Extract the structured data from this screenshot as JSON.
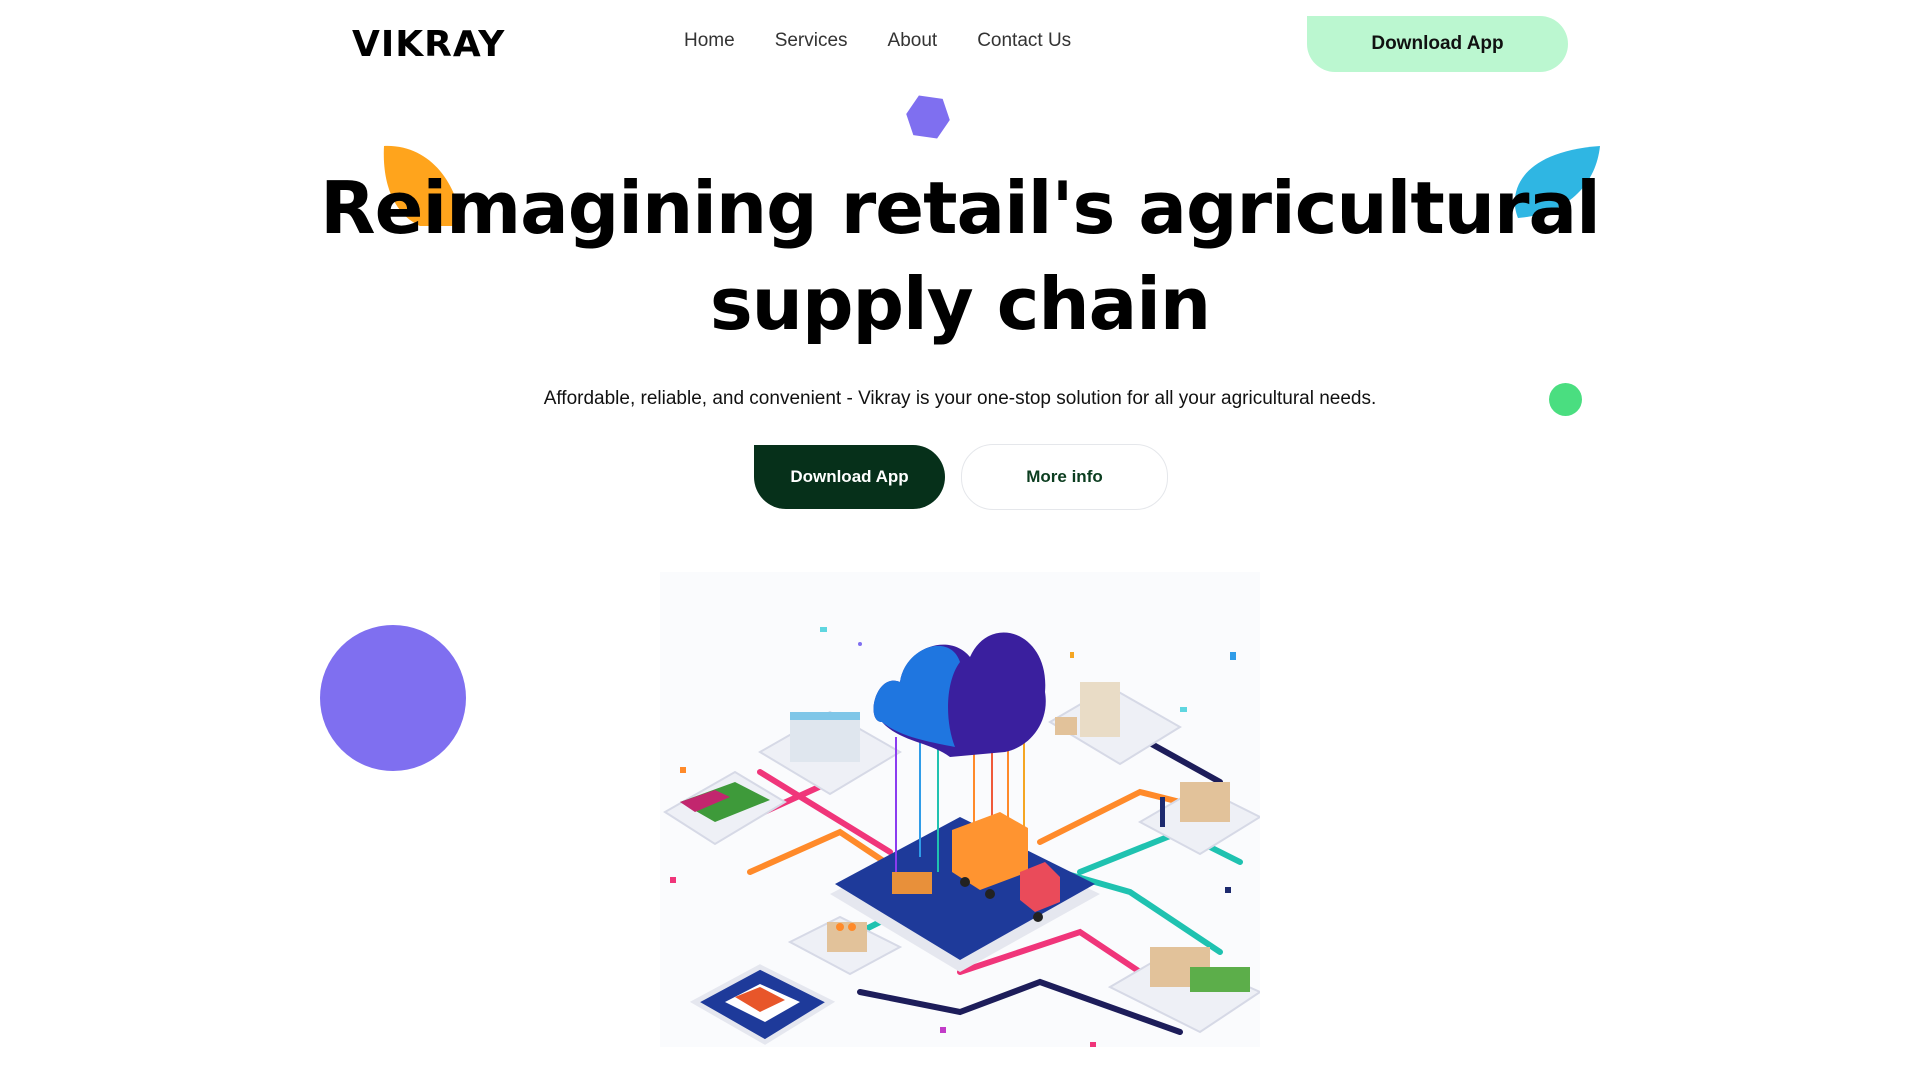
{
  "header": {
    "logo_text": "VIKRAY",
    "nav": [
      "Home",
      "Services",
      "About",
      "Contact Us"
    ],
    "download_label": "Download App"
  },
  "hero": {
    "title_line1": "Reimagining retail's agricultural",
    "title_line2": "supply chain",
    "subtitle": "Affordable, reliable, and convenient - Vikray is your one-stop solution for all your agricultural needs.",
    "primary_button": "Download App",
    "secondary_button": "More info"
  },
  "colors": {
    "accent_green_light": "#bbf7d0",
    "primary_dark_green": "#06301a",
    "purple": "#7f6ff0",
    "orange": "#ffa41c",
    "blue": "#2fb6e3",
    "green_dot": "#4ade80"
  }
}
